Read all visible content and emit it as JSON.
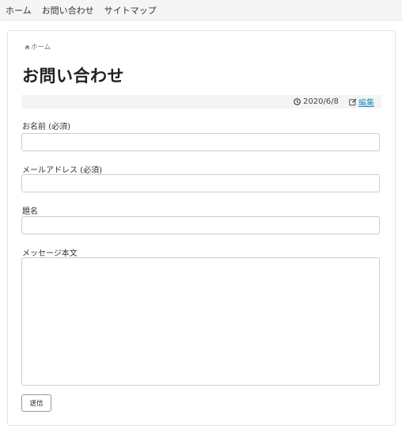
{
  "topnav": {
    "items": [
      {
        "label": "ホーム"
      },
      {
        "label": "お問い合わせ"
      },
      {
        "label": "サイトマップ"
      }
    ]
  },
  "breadcrumb": {
    "home_label": "ホーム",
    "icon": "home-icon"
  },
  "page": {
    "title": "お問い合わせ"
  },
  "meta": {
    "date": "2020/6/8",
    "date_icon": "clock-icon",
    "edit_label": "編集",
    "edit_icon": "edit-icon"
  },
  "form": {
    "name_label": "お名前 (必須)",
    "name_value": "",
    "email_label": "メールアドレス (必須)",
    "email_value": "",
    "subject_label": "題名",
    "subject_value": "",
    "message_label": "メッセージ本文",
    "message_value": "",
    "submit_label": "送信"
  },
  "colors": {
    "link": "#1a8fbf",
    "nav_bg": "#f5f5f5",
    "meta_bg": "#f4f4f4"
  }
}
